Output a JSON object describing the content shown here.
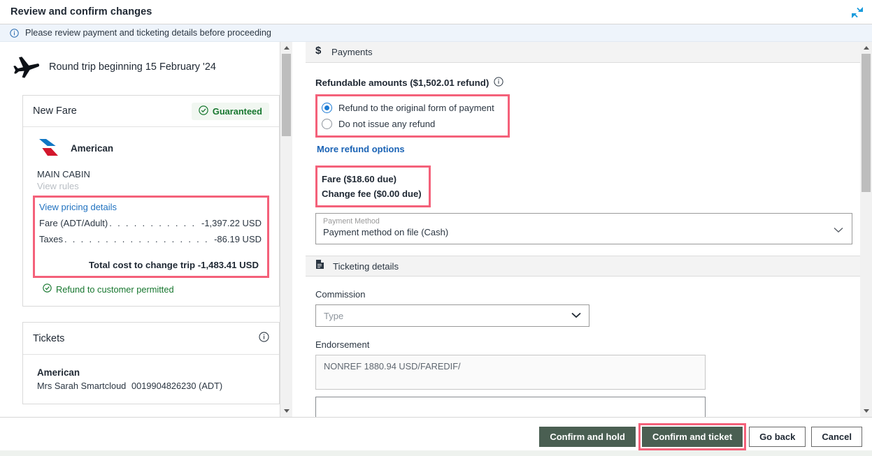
{
  "window": {
    "title": "Review and confirm changes",
    "collapse_icon": "collapse-arrows-icon"
  },
  "banner": {
    "icon": "info-circle-icon",
    "text": "Please review payment and ticketing details before proceeding"
  },
  "left": {
    "trip": {
      "icon": "airplane-icon",
      "title": "Round trip beginning 15 February '24"
    },
    "fare_card": {
      "header": "New Fare",
      "badge": {
        "icon": "check-circle-icon",
        "label": "Guaranteed"
      },
      "carrier": "American",
      "carrier_logo": "american-airlines-logo-icon",
      "cabin": "MAIN CABIN",
      "view_rules": "View rules",
      "view_pricing_details": "View pricing details",
      "lines": [
        {
          "label": "Fare (ADT/Adult)",
          "amount": "-1,397.22 USD"
        },
        {
          "label": "Taxes",
          "amount": "-86.19 USD"
        }
      ],
      "total": "Total cost to change trip -1,483.41 USD",
      "refund_note": {
        "icon": "check-circle-icon",
        "label": "Refund to customer permitted"
      }
    },
    "tickets_card": {
      "header": "Tickets",
      "info_icon": "info-circle-icon",
      "carrier": "American",
      "passenger": "Mrs Sarah Smartcloud",
      "ticket_number": "0019904826230 (ADT)"
    }
  },
  "right": {
    "payments": {
      "icon": "dollar-icon",
      "header": "Payments",
      "refundable_title": "Refundable amounts ($1,502.01 refund)",
      "refundable_info_icon": "info-circle-icon",
      "options": [
        {
          "label": "Refund to the original form of payment",
          "selected": true
        },
        {
          "label": "Do not issue any refund",
          "selected": false
        }
      ],
      "more_refund_options": "More refund options",
      "fare_due": "Fare ($18.60 due)",
      "change_fee_due": "Change fee ($0.00 due)",
      "payment_method": {
        "label": "Payment Method",
        "value": "Payment method on file (Cash)",
        "chevron_icon": "chevron-down-icon"
      }
    },
    "ticketing": {
      "icon": "document-icon",
      "header": "Ticketing details",
      "commission_label": "Commission",
      "commission_placeholder": "Type",
      "commission_chevron_icon": "chevron-down-icon",
      "endorsement_label": "Endorsement",
      "endorsement_value": "NONREF 1880.94 USD/FAREDIF/",
      "extra_field_1": "",
      "extra_field_2": ""
    }
  },
  "footer": {
    "confirm_and_hold": "Confirm and hold",
    "confirm_and_ticket": "Confirm and ticket",
    "go_back": "Go back",
    "cancel": "Cancel"
  },
  "colors": {
    "accent_blue": "#1a7ad4",
    "highlight_pink": "#f4617a",
    "primary_button": "#4a5f52",
    "success_green": "#17772f",
    "banner_bg": "#eef4fb"
  }
}
